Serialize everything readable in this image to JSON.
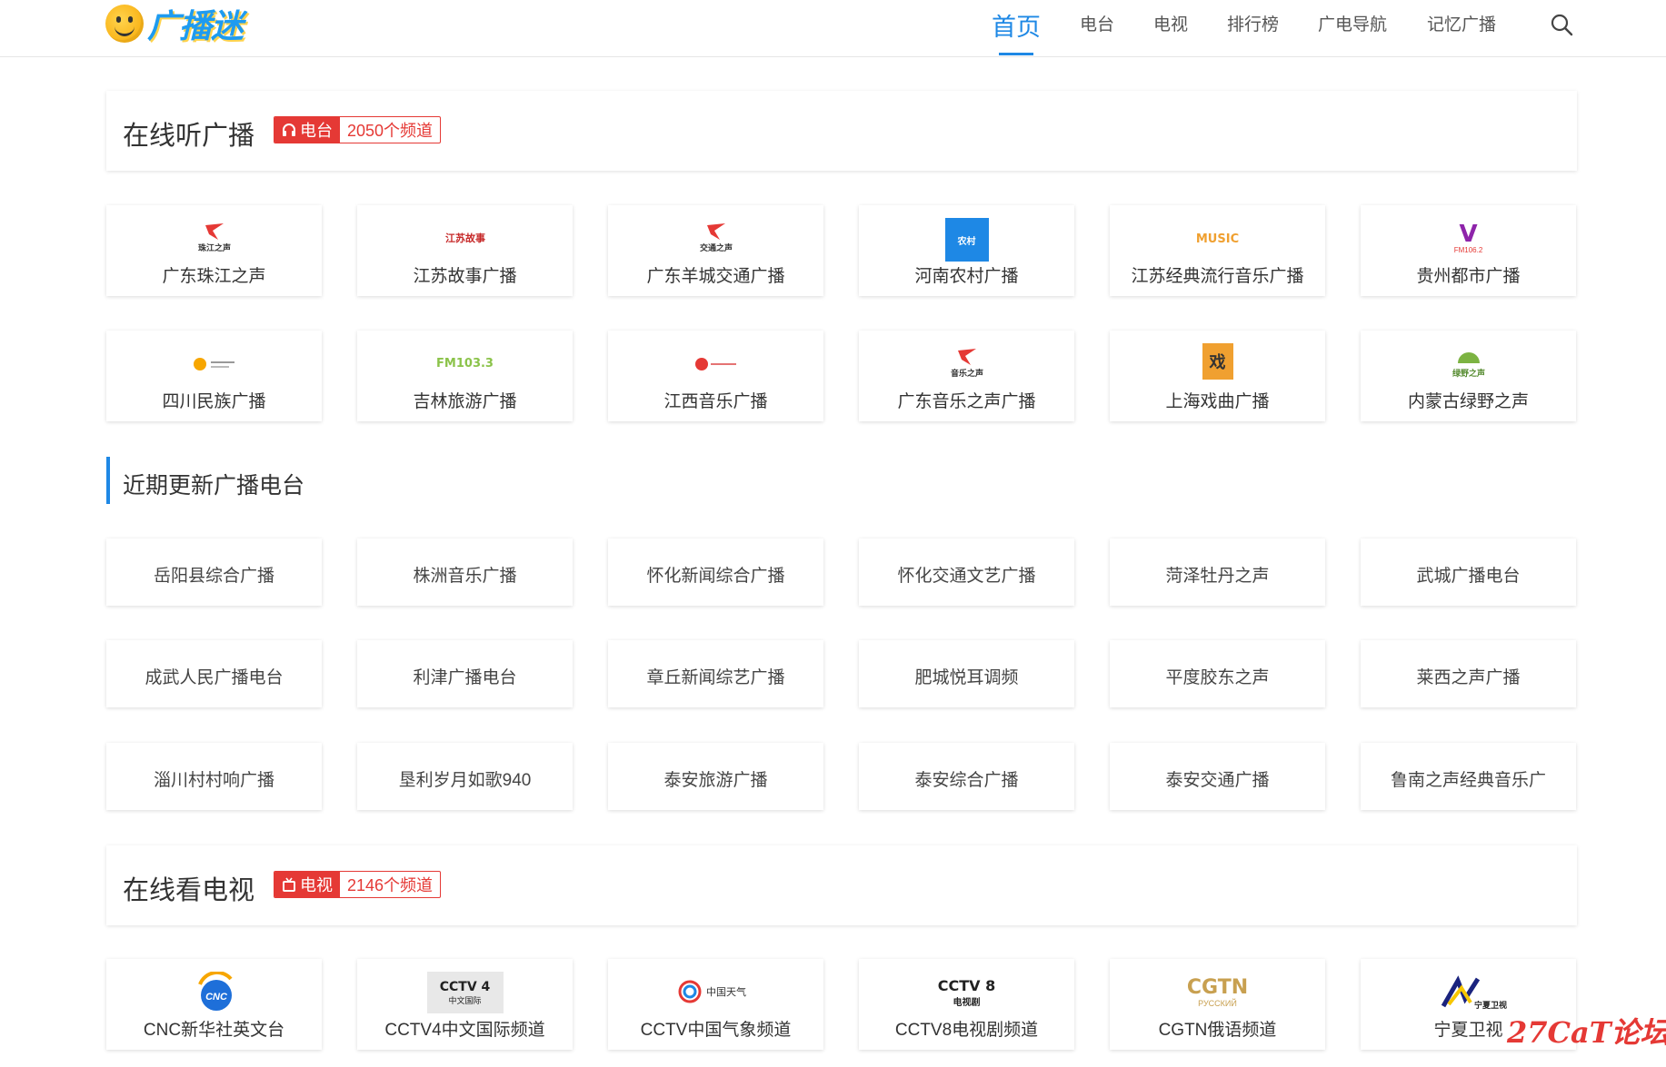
{
  "site": {
    "logo_text": "广播迷"
  },
  "nav": {
    "items": [
      "首页",
      "电台",
      "电视",
      "排行榜",
      "广电导航",
      "记忆广播"
    ]
  },
  "radio_section": {
    "title": "在线听广播",
    "badge_label": "电台",
    "badge_count": "2050个频道",
    "stations": [
      "广东珠江之声",
      "江苏故事广播",
      "广东羊城交通广播",
      "河南农村广播",
      "江苏经典流行音乐广播",
      "贵州都市广播",
      "四川民族广播",
      "吉林旅游广播",
      "江西音乐广播",
      "广东音乐之声广播",
      "上海戏曲广播",
      "内蒙古绿野之声"
    ]
  },
  "recent_section": {
    "title": "近期更新广播电台",
    "stations": [
      "岳阳县综合广播",
      "株洲音乐广播",
      "怀化新闻综合广播",
      "怀化交通文艺广播",
      "菏泽牡丹之声",
      "武城广播电台",
      "成武人民广播电台",
      "利津广播电台",
      "章丘新闻综艺广播",
      "肥城悦耳调频",
      "平度胶东之声",
      "莱西之声广播",
      "淄川村村响广播",
      "垦利岁月如歌940",
      "泰安旅游广播",
      "泰安综合广播",
      "泰安交通广播",
      "鲁南之声经典音乐广"
    ]
  },
  "tv_section": {
    "title": "在线看电视",
    "badge_label": "电视",
    "badge_count": "2146个频道",
    "channels": [
      "CNC新华社英文台",
      "CCTV4中文国际频道",
      "CCTV中国气象频道",
      "CCTV8电视剧频道",
      "CGTN俄语频道",
      "宁夏卫视"
    ]
  },
  "logo_texts": {
    "zhujiang": "珠江之声",
    "jiangsu_story": "江苏故事",
    "yangcheng": "交通之声",
    "henan": "农村",
    "music": "MUSIC",
    "guizhou": "V",
    "guizhou_freq": "FM106.2",
    "jilin": "FM103.3",
    "guangdong_music": "音乐之声",
    "shanghai": "戏",
    "neimeng": "绿野之声",
    "cnc": "CNC",
    "cctv4": "CCTV 4",
    "cctv4_sub": "中文国际",
    "weather": "中国天气",
    "cctv8": "CCTV 8",
    "cctv8_sub": "电视剧",
    "cgtn": "CGTN",
    "cgtn_sub": "РУССКИЙ",
    "ningxia": "宁夏卫视"
  },
  "watermark": "27CaT论坛",
  "colors": {
    "accent": "#1e88e5",
    "badge": "#e53935"
  }
}
